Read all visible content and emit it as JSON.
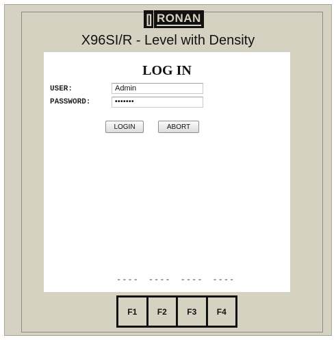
{
  "brand": {
    "logo_text": "RONAN"
  },
  "device": {
    "model_title": "X96SI/R - Level with Density"
  },
  "login": {
    "title": "LOG IN",
    "user_label": "USER:",
    "user_value": "Admin",
    "password_label": "PASSWORD:",
    "password_value": "•••••••",
    "login_button": "LOGIN",
    "abort_button": "ABORT"
  },
  "status": {
    "dashes": [
      "----",
      "----",
      "----",
      "----"
    ]
  },
  "function_keys": [
    "F1",
    "F2",
    "F3",
    "F4"
  ]
}
